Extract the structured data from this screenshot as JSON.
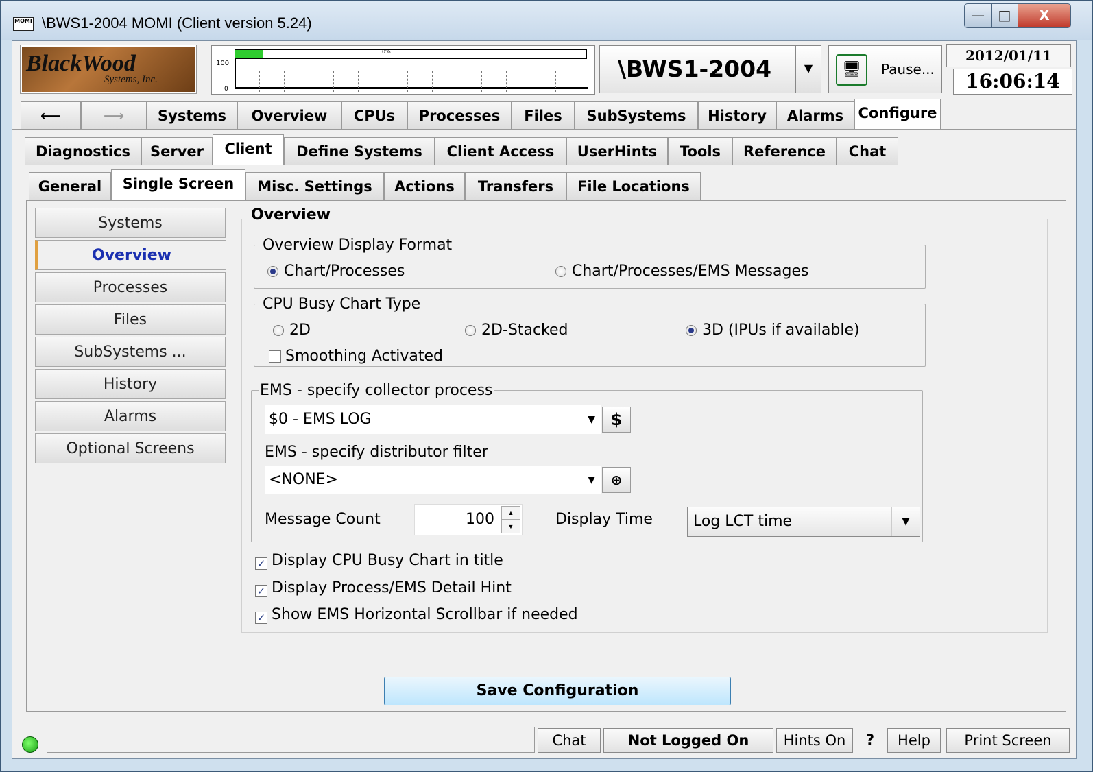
{
  "window": {
    "app_icon_text": "MOMI",
    "title": "\\BWS1-2004 MOMI (Client version 5.24)",
    "controls": {
      "minimize": "—",
      "maximize": "□",
      "close": "X"
    }
  },
  "header": {
    "logo_line1": "BlackWood",
    "logo_line2": "Systems, Inc.",
    "graph": {
      "label_max": "100",
      "label_min": "0",
      "busy_label": "0%",
      "busy_fraction": 0.08
    },
    "system_name": "\\BWS1-2004",
    "pause_label": "Pause...",
    "date": "2012/01/11",
    "time": "16:06:14"
  },
  "main_tabs": [
    "Systems",
    "Overview",
    "CPUs",
    "Processes",
    "Files",
    "SubSystems",
    "History",
    "Alarms",
    "Configure"
  ],
  "main_tabs_selected": "Configure",
  "config_tabs": [
    "Diagnostics",
    "Server",
    "Client",
    "Define Systems",
    "Client Access",
    "UserHints",
    "Tools",
    "Reference",
    "Chat"
  ],
  "client_tabs": [
    "General",
    "Single Screen",
    "Misc. Settings",
    "Actions",
    "Transfers",
    "File Locations"
  ],
  "side_nav": [
    "Systems",
    "Overview",
    "Processes",
    "Files",
    "SubSystems ...",
    "History",
    "Alarms",
    "Optional Screens"
  ],
  "overview": {
    "title": "Overview",
    "display_format": {
      "legend": "Overview Display Format",
      "opt1": "Chart/Processes",
      "opt2": "Chart/Processes/EMS Messages",
      "selected": "Chart/Processes"
    },
    "cpu_chart": {
      "legend": "CPU Busy Chart Type",
      "opt1": "2D",
      "opt2": "2D-Stacked",
      "opt3": "3D (IPUs if available)",
      "selected": "3D (IPUs if available)",
      "smoothing_label": "Smoothing Activated",
      "smoothing_checked": false
    },
    "ems": {
      "legend": "EMS - specify collector process",
      "collector_value": "$0 - EMS LOG",
      "collector_btn": "$",
      "filter_label": "EMS - specify distributor filter",
      "filter_value": "<NONE>",
      "filter_btn": "⊕",
      "message_count_label": "Message Count",
      "message_count": "100",
      "display_time_label": "Display Time",
      "display_time_value": "Log LCT time"
    },
    "checks": {
      "cpu_title": "Display CPU Busy Chart in title",
      "detail_hint": "Display Process/EMS Detail Hint",
      "h_scrollbar": "Show EMS Horizontal Scrollbar if needed"
    },
    "save_label": "Save Configuration"
  },
  "status": {
    "chat": "Chat",
    "login": "Not Logged On",
    "hints": "Hints On",
    "question": "?",
    "help": "Help",
    "print": "Print Screen"
  }
}
